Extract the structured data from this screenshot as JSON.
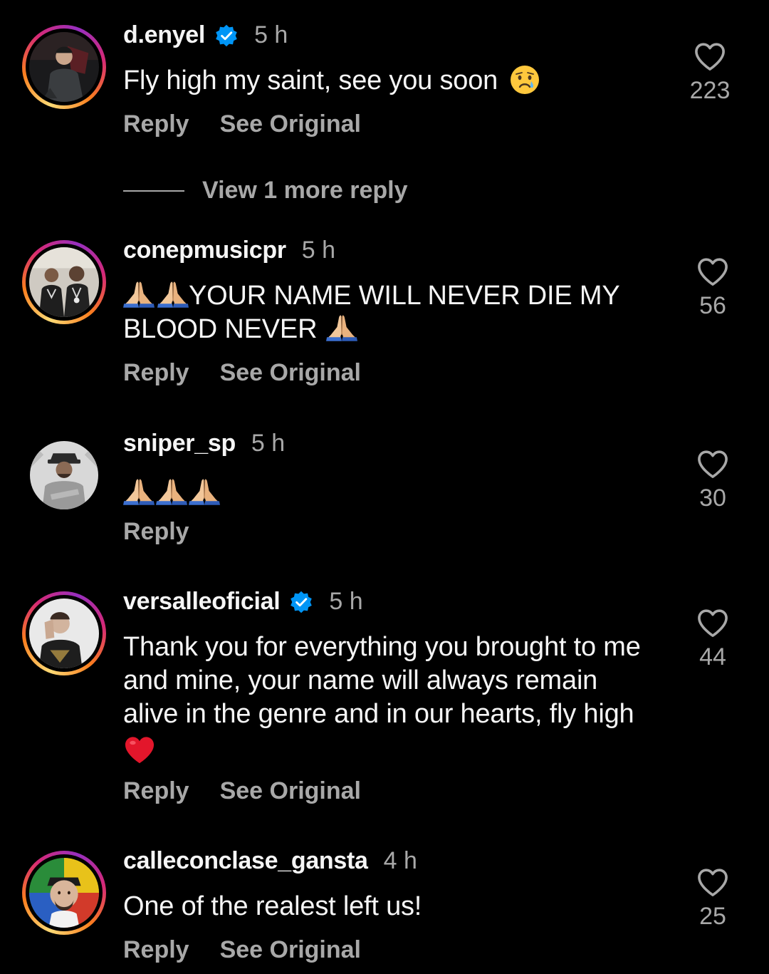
{
  "comments": [
    {
      "username": "d.enyel",
      "verified": true,
      "time": "5 h",
      "text": "Fly high my saint, see you soon",
      "emoji_after": "crying-face",
      "reply_label": "Reply",
      "see_original_label": "See Original",
      "likes": "223",
      "view_replies": "View 1 more reply"
    },
    {
      "username": "conepmusicpr",
      "verified": false,
      "time": "5 h",
      "text_line1": "YOUR NAME WILL NEVER DIE MY",
      "text_line2": "BLOOD NEVER",
      "reply_label": "Reply",
      "see_original_label": "See Original",
      "likes": "56"
    },
    {
      "username": "sniper_sp",
      "verified": false,
      "time": "5 h",
      "text": "",
      "reply_label": "Reply",
      "likes": "30"
    },
    {
      "username": "versalleoficial",
      "verified": true,
      "time": "5 h",
      "text_line1": "Thank you for everything you brought to me",
      "text_line2": "and mine, your name will always remain",
      "text_line3": "alive in the genre and in our hearts, fly high",
      "reply_label": "Reply",
      "see_original_label": "See Original",
      "likes": "44"
    },
    {
      "username": "calleconclase_gansta",
      "verified": false,
      "time": "4 h",
      "text": "One of the realest left us!",
      "reply_label": "Reply",
      "see_original_label": "See Original",
      "likes": "25"
    }
  ],
  "colors": {
    "background": "#000000",
    "primary_text": "#f5f5f5",
    "secondary_text": "#a8a8a8",
    "verified_blue": "#0095f6"
  },
  "icons": {
    "like": "heart-outline-icon",
    "verified": "verified-badge-icon",
    "prayer": "folded-hands-emoji",
    "heart": "red-heart-emoji"
  }
}
